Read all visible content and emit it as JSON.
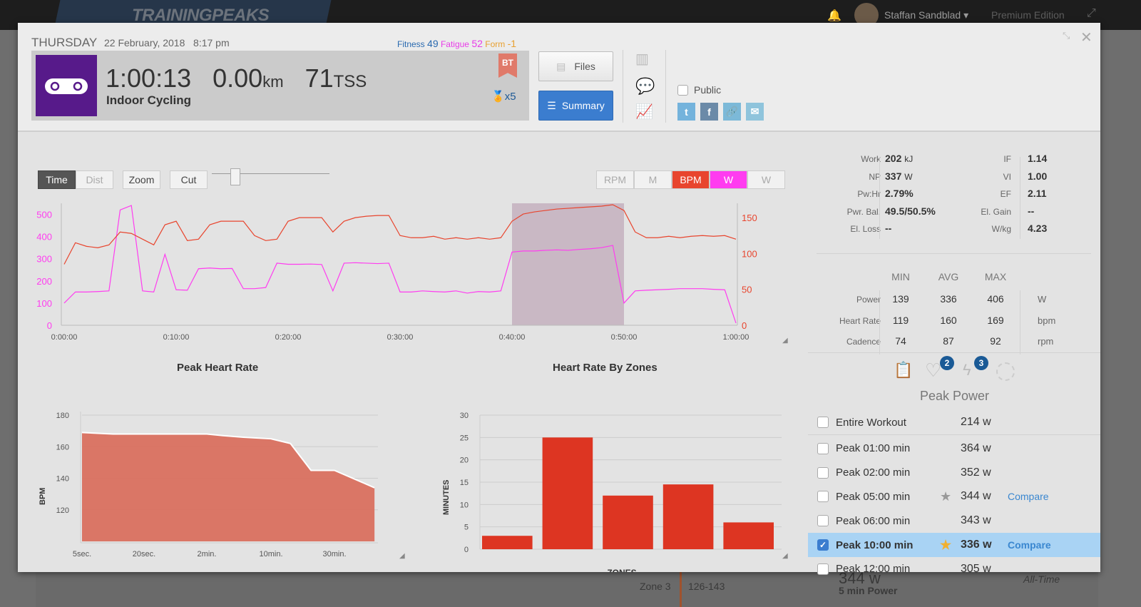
{
  "app": {
    "brand": "TRAININGPEAKS",
    "user": "Staffan Sandblad",
    "edition": "Premium Edition"
  },
  "background": {
    "zone": "Zone 3",
    "range": "126-143",
    "power_value": "344 w",
    "power_label": "5 min Power",
    "alltime": "All-Time"
  },
  "header": {
    "day": "THURSDAY",
    "date": "22 February, 2018",
    "time": "8:17 pm",
    "fitness_label": "Fitness",
    "fitness": "49",
    "fatigue_label": "Fatigue",
    "fatigue": "52",
    "form_label": "Form",
    "form": "-1",
    "duration": "1:00:13",
    "distance": "0.00",
    "distance_unit": "km",
    "tss": "71",
    "tss_unit": "TSS",
    "sport": "Indoor Cycling",
    "badge": "BT",
    "medal_count": "x5",
    "files_label": "Files",
    "summary_label": "Summary",
    "public_label": "Public",
    "colors": {
      "fitness": "#2a6ab0",
      "fatigue": "#e83ce8",
      "form": "#e8a030",
      "sport": "#571a8a",
      "accent": "#3b7dcf"
    }
  },
  "toolbar": {
    "time": "Time",
    "dist": "Dist",
    "zoom": "Zoom",
    "cut": "Cut",
    "channels": [
      "RPM",
      "M",
      "BPM",
      "W",
      "W"
    ]
  },
  "chart_data": [
    {
      "type": "line",
      "x_ticks": [
        "0:00:00",
        "0:10:00",
        "0:20:00",
        "0:30:00",
        "0:40:00",
        "0:50:00",
        "1:00:00"
      ],
      "y_left_ticks": [
        "0",
        "100",
        "200",
        "300",
        "400",
        "500"
      ],
      "y_right_ticks": [
        "0",
        "50",
        "100",
        "150"
      ],
      "ylim_left": [
        0,
        550
      ],
      "ylim_right": [
        0,
        170
      ],
      "xlim_min": [
        0,
        60
      ],
      "selection_min": [
        40,
        50
      ],
      "series": [
        {
          "color": "#ff3cf0",
          "axis": "left",
          "values": [
            100,
            150,
            150,
            152,
            155,
            520,
            540,
            155,
            150,
            320,
            160,
            158,
            255,
            258,
            255,
            256,
            165,
            165,
            170,
            280,
            275,
            275,
            276,
            274,
            155,
            280,
            282,
            280,
            278,
            280,
            150,
            150,
            155,
            152,
            150,
            155,
            145,
            152,
            150,
            155,
            330,
            335,
            335,
            338,
            340,
            338,
            342,
            345,
            350,
            360,
            100,
            155,
            158,
            160,
            162,
            165,
            165,
            165,
            162,
            160,
            10
          ]
        },
        {
          "color": "#e8452e",
          "axis": "right",
          "values": [
            85,
            115,
            110,
            108,
            112,
            130,
            128,
            120,
            112,
            140,
            145,
            118,
            120,
            140,
            145,
            145,
            145,
            125,
            118,
            120,
            145,
            150,
            150,
            150,
            130,
            145,
            150,
            152,
            153,
            153,
            125,
            122,
            122,
            124,
            120,
            122,
            120,
            122,
            120,
            122,
            145,
            155,
            158,
            160,
            162,
            163,
            164,
            165,
            166,
            168,
            160,
            130,
            122,
            122,
            124,
            122,
            124,
            125,
            124,
            125,
            120
          ]
        }
      ]
    },
    {
      "type": "area",
      "title": "Peak Heart Rate",
      "ylabel": "BPM",
      "ylim": [
        100,
        180
      ],
      "y_ticks": [
        "120",
        "140",
        "160",
        "180"
      ],
      "x_ticks": [
        "5sec.",
        "20sec.",
        "2min.",
        "10min.",
        "30min."
      ],
      "points_sec": [
        5,
        10,
        20,
        60,
        120,
        180,
        300,
        600,
        840,
        1200,
        1800,
        3600
      ],
      "values": [
        169,
        168,
        168,
        168,
        168,
        167,
        166,
        165,
        162,
        145,
        145,
        134
      ],
      "color": "#d9705f"
    },
    {
      "type": "bar",
      "title": "Heart Rate By Zones",
      "ylabel": "MINUTES",
      "xlabel": "ZONES",
      "ylim": [
        0,
        30
      ],
      "y_ticks": [
        "0",
        "5",
        "10",
        "15",
        "20",
        "25",
        "30"
      ],
      "values": [
        3,
        25,
        12,
        14.5,
        6
      ],
      "color": "#dd3522"
    }
  ],
  "stats": {
    "left": [
      {
        "label": "Work",
        "value": "202",
        "unit": "kJ"
      },
      {
        "label": "NP",
        "value": "337",
        "unit": "W"
      },
      {
        "label": "Pw:Hr",
        "value": "2.79%",
        "unit": ""
      },
      {
        "label": "Pwr. Bal.",
        "value": "49.5/50.5%",
        "unit": ""
      },
      {
        "label": "El. Loss",
        "value": "--",
        "unit": ""
      }
    ],
    "right": [
      {
        "label": "IF",
        "value": "1.14"
      },
      {
        "label": "VI",
        "value": "1.00"
      },
      {
        "label": "EF",
        "value": "2.11"
      },
      {
        "label": "El. Gain",
        "value": "--"
      },
      {
        "label": "W/kg",
        "value": "4.23"
      }
    ],
    "minmax_headers": [
      "MIN",
      "AVG",
      "MAX"
    ],
    "minmax": [
      {
        "label": "Power",
        "min": "139",
        "avg": "336",
        "max": "406",
        "unit": "W"
      },
      {
        "label": "Heart Rate",
        "min": "119",
        "avg": "160",
        "max": "169",
        "unit": "bpm"
      },
      {
        "label": "Cadence",
        "min": "74",
        "avg": "87",
        "max": "92",
        "unit": "rpm"
      }
    ]
  },
  "peaks": {
    "heart_badge": "2",
    "power_badge": "3",
    "title": "Peak Power",
    "compare": "Compare",
    "rows": [
      {
        "label": "Entire Workout",
        "value": "214 w",
        "checked": false
      },
      {
        "label": "Peak 01:00 min",
        "value": "364 w"
      },
      {
        "label": "Peak 02:00 min",
        "value": "352 w"
      },
      {
        "label": "Peak 05:00 min",
        "value": "344 w",
        "medal": "silver",
        "compare": true
      },
      {
        "label": "Peak 06:00 min",
        "value": "343 w"
      },
      {
        "label": "Peak 10:00 min",
        "value": "336 w",
        "medal": "gold",
        "compare": true,
        "checked": true
      },
      {
        "label": "Peak 12:00 min",
        "value": "305 w"
      }
    ]
  }
}
